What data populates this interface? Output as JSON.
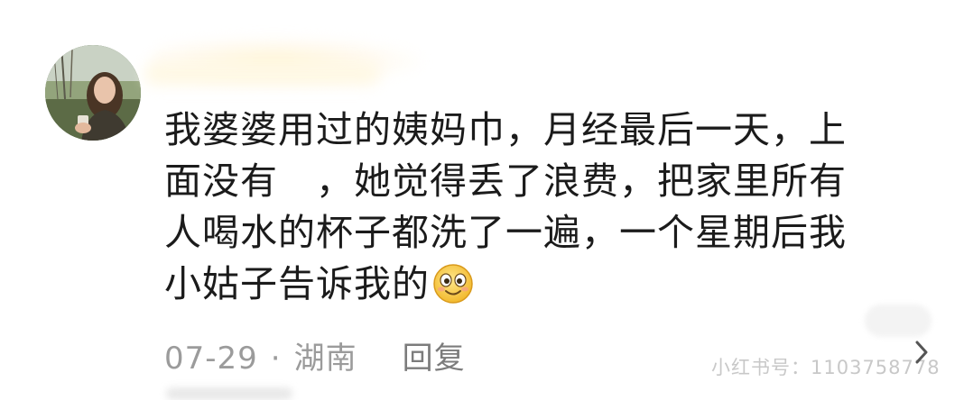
{
  "comment": {
    "text_lines": [
      "我婆婆用过的姨妈巾，月经最后一天，上",
      "面没有　，她觉得丢了浪费，把家里所有",
      "人喝水的杯子都洗了一遍，一个星期后我",
      "小姑子告诉我的"
    ],
    "emoji_icon": "smiling-face-emoji-icon"
  },
  "meta": {
    "date": "07-29",
    "separator": "·",
    "location": "湖南",
    "reply_label": "回复"
  },
  "watermark": {
    "text": "小红书号：1103758778"
  },
  "colors": {
    "text": "#1b1b1b",
    "meta": "#9b9b9b",
    "reply": "#7c7c7c",
    "watermark": "#c8c8c8",
    "emoji_face": "#f7c948"
  }
}
